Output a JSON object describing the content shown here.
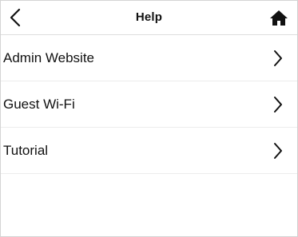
{
  "header": {
    "title": "Help",
    "back_icon": "chevron-left-icon",
    "home_icon": "home-icon"
  },
  "menu": {
    "items": [
      {
        "label": "Admin Website",
        "icon": "chevron-right-icon"
      },
      {
        "label": "Guest Wi-Fi",
        "icon": "chevron-right-icon"
      },
      {
        "label": "Tutorial",
        "icon": "chevron-right-icon"
      }
    ]
  },
  "colors": {
    "text": "#111111",
    "divider": "#ececec",
    "background": "#ffffff"
  }
}
